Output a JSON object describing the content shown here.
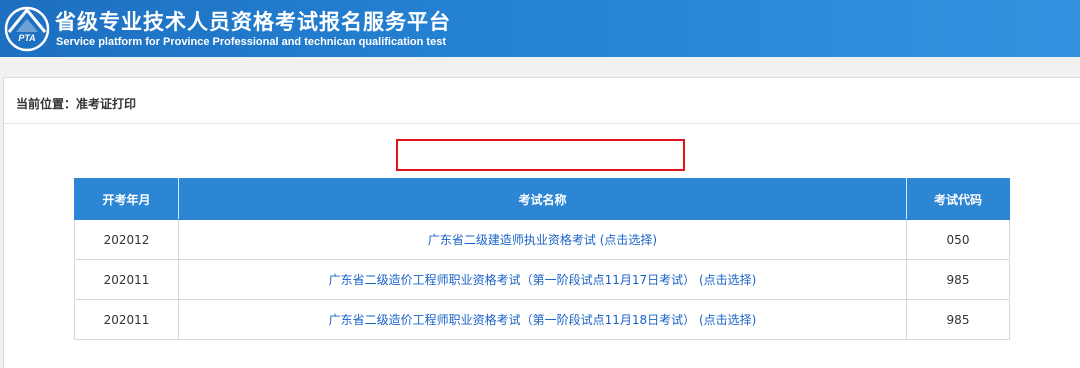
{
  "header": {
    "logo_text": "PTA",
    "title": "省级专业技术人员资格考试报名服务平台",
    "subtitle": "Service platform for Province Professional and technican qualification test"
  },
  "breadcrumb": "当前位置：准考证打印",
  "table": {
    "columns": [
      "开考年月",
      "考试名称",
      "考试代码"
    ],
    "rows": [
      {
        "date": "202012",
        "name": "广东省二级建造师执业资格考试 (点击选择)",
        "code": "050",
        "highlighted": true
      },
      {
        "date": "202011",
        "name": "广东省二级造价工程师职业资格考试（第一阶段试点11月17日考试） (点击选择)",
        "code": "985",
        "highlighted": false
      },
      {
        "date": "202011",
        "name": "广东省二级造价工程师职业资格考试（第一阶段试点11月18日考试） (点击选择)",
        "code": "985",
        "highlighted": false
      }
    ]
  },
  "colors": {
    "header_blue": "#2582d4",
    "table_header_blue": "#2c86d4",
    "link_blue": "#1a63c8",
    "highlight_red": "#e1141b"
  }
}
